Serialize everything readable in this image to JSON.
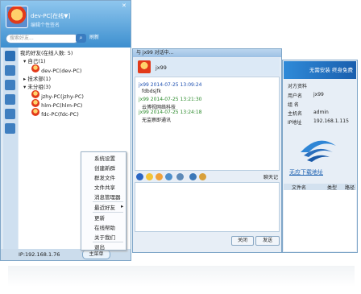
{
  "main": {
    "user": "dev-PC[在线▼]",
    "signature": "编辑个性签名",
    "search_placeholder": "搜索好友...",
    "refresh": "刷新",
    "header": "我的好友(在线人数: 5)",
    "groups": [
      {
        "label": "自己(1)",
        "members": [
          "dev-PC(dev-PC)"
        ]
      },
      {
        "label": "技术部(1)",
        "members": []
      },
      {
        "label": "未分组(3)",
        "members": [
          "jzhy-PC(jzhy-PC)",
          "hlm-PC(hlm-PC)",
          "fdc-PC(fdc-PC)"
        ]
      }
    ],
    "ip": "IP:192.168.1.76",
    "main_menu": "主菜单"
  },
  "menu": {
    "items": [
      "系统设置",
      "创建新群",
      "群发文件",
      "文件共享",
      "消息管理器",
      "最近好友",
      "更新",
      "在线帮助",
      "关于我们",
      "退出"
    ]
  },
  "chat": {
    "title": "与 jx99 对话中...",
    "contact": "jx99",
    "messages": [
      {
        "header": "jx99 2014-07-25 13:09:24",
        "body": "fdbdsjfk"
      },
      {
        "header": "jx99 2014-07-25 13:21:30",
        "body": "云博视网络科技"
      },
      {
        "header": "jx99 2014-07-25 13:24:18",
        "body": "无监察即通讯"
      }
    ],
    "record": "聊天记录",
    "close": "关闭",
    "send": "发送"
  },
  "profile": {
    "banner": "无需安装 终身免费",
    "title": "对方资料",
    "rows": [
      {
        "k": "用户名",
        "v": "jx99"
      },
      {
        "k": "组 名",
        "v": ""
      },
      {
        "k": "主机名",
        "v": "admin"
      },
      {
        "k": "IP地址",
        "v": "192.168.1.115"
      }
    ],
    "download": "无应下载地址",
    "file_col": "文件名",
    "type_col": "类型",
    "path_col": "路径"
  }
}
